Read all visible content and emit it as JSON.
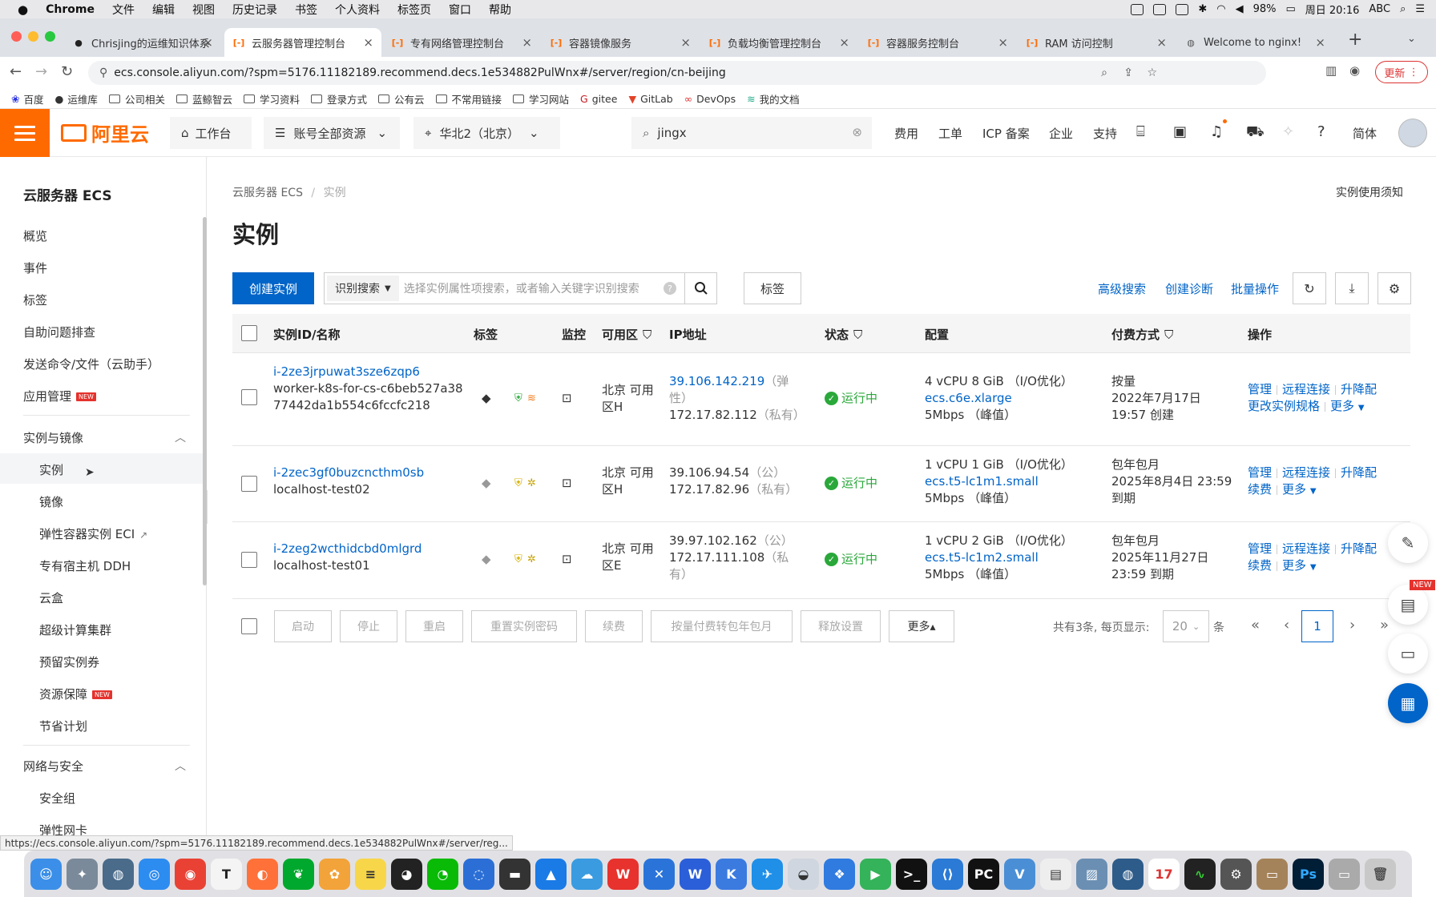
{
  "menubar": {
    "apple": "",
    "items": [
      "Chrome",
      "文件",
      "编辑",
      "视图",
      "历史记录",
      "书签",
      "个人资料",
      "标签页",
      "窗口",
      "帮助"
    ],
    "battery": "98%",
    "clock": "周日 20:16",
    "ime": "ABC"
  },
  "tabs": [
    {
      "title": "Chrisjing的运维知识体系",
      "icon": "github"
    },
    {
      "title": "云服务器管理控制台",
      "icon": "aliyun",
      "active": true
    },
    {
      "title": "专有网络管理控制台",
      "icon": "aliyun"
    },
    {
      "title": "容器镜像服务",
      "icon": "aliyun"
    },
    {
      "title": "负载均衡管理控制台",
      "icon": "aliyun"
    },
    {
      "title": "容器服务控制台",
      "icon": "aliyun"
    },
    {
      "title": "RAM 访问控制",
      "icon": "aliyun"
    },
    {
      "title": "Welcome to nginx!",
      "icon": "globe"
    }
  ],
  "address": {
    "url": "ecs.console.aliyun.com/?spm=5176.11182189.recommend.decs.1e534882PulWnx#/server/region/cn-beijing",
    "update_label": "更新"
  },
  "bookmarks": [
    "百度",
    "运维库",
    "公司相关",
    "蓝鲸智云",
    "学习资料",
    "登录方式",
    "公有云",
    "不常用链接",
    "学习网站",
    "gitee",
    "GitLab",
    "DevOps",
    "我的文档"
  ],
  "topnav": {
    "logo": "阿里云",
    "workbench": "工作台",
    "resources": "账号全部资源",
    "region": "华北2（北京）",
    "search_value": "jingx",
    "links": [
      "费用",
      "工单",
      "ICP 备案",
      "企业",
      "支持"
    ],
    "lang": "简体"
  },
  "sidebar": {
    "title": "云服务器 ECS",
    "top_items": [
      "概览",
      "事件",
      "标签",
      "自助问题排查",
      "发送命令/文件（云助手）",
      "应用管理"
    ],
    "group1": "实例与镜像",
    "group1_items": [
      "实例",
      "镜像",
      "弹性容器实例 ECI",
      "专有宿主机 DDH",
      "云盒",
      "超级计算集群",
      "预留实例券",
      "资源保障",
      "节省计划"
    ],
    "group2": "网络与安全",
    "group2_items": [
      "安全组",
      "弹性网卡"
    ],
    "new_badge": "NEW"
  },
  "main": {
    "breadcrumb_root": "云服务器 ECS",
    "breadcrumb_sep": "/",
    "breadcrumb_current": "实例",
    "title": "实例",
    "notice": "实例使用须知",
    "create_label": "创建实例",
    "search_mode": "识别搜索",
    "search_placeholder": "选择实例属性项搜索，或者输入关键字识别搜索",
    "tag_btn": "标签",
    "links": [
      "高级搜索",
      "创建诊断",
      "批量操作"
    ]
  },
  "table": {
    "headers": [
      "实例ID/名称",
      "标签",
      "监控",
      "可用区",
      "IP地址",
      "状态",
      "配置",
      "付费方式",
      "操作"
    ],
    "rows": [
      {
        "id": "i-2ze3jrpuwat3sze6zqp6",
        "name": "worker-k8s-for-cs-c6beb527a3877442da1b554c6fccfc218",
        "zone": "北京 可用区H",
        "ip1": "39.106.142.219",
        "ip1_tag": "（弹性）",
        "ip2": "172.17.82.112",
        "ip2_tag": "（私有）",
        "status": "运行中",
        "spec": "4 vCPU 8 GiB （I/O优化）",
        "type": "ecs.c6e.xlarge",
        "bw": "5Mbps （峰值）",
        "pay1": "按量",
        "pay2": "2022年7月17日",
        "pay3": "19:57 创建",
        "ops1": [
          "管理",
          "远程连接",
          "升降配"
        ],
        "ops2": [
          "更改实例规格",
          "更多"
        ]
      },
      {
        "id": "i-2zec3gf0buzcncthm0sb",
        "name": "localhost-test02",
        "zone": "北京 可用区H",
        "ip1": "39.106.94.54",
        "ip1_tag": "（公）",
        "ip2": "172.17.82.96",
        "ip2_tag": "（私有）",
        "status": "运行中",
        "spec": "1 vCPU 1 GiB （I/O优化）",
        "type": "ecs.t5-lc1m1.small",
        "bw": "5Mbps （峰值）",
        "pay1": "包年包月",
        "pay2": "2025年8月4日 23:59",
        "pay3": "到期",
        "ops1": [
          "管理",
          "远程连接",
          "升降配"
        ],
        "ops2": [
          "续费",
          "更多"
        ]
      },
      {
        "id": "i-2zeg2wcthidcbd0mlgrd",
        "name": "localhost-test01",
        "zone": "北京 可用区E",
        "ip1": "39.97.102.162",
        "ip1_tag": "（公）",
        "ip2": "172.17.111.108",
        "ip2_tag": "（私有）",
        "status": "运行中",
        "spec": "1 vCPU 2 GiB （I/O优化）",
        "type": "ecs.t5-lc1m2.small",
        "bw": "5Mbps （峰值）",
        "pay1": "包年包月",
        "pay2": "2025年11月27日",
        "pay3": "23:59 到期",
        "ops1": [
          "管理",
          "远程连接",
          "升降配"
        ],
        "ops2": [
          "续费",
          "更多"
        ]
      }
    ]
  },
  "batch": [
    "启动",
    "停止",
    "重启",
    "重置实例密码",
    "续费",
    "按量付费转包年包月",
    "释放设置",
    "更多▴"
  ],
  "pagination": {
    "summary": "共有3条, 每页显示:",
    "page_size": "20",
    "unit": "条",
    "current": "1"
  },
  "float_new": "NEW",
  "statusbar_url": "https://ecs.console.aliyun.com/?spm=5176.11182189.recommend.decs.1e534882PulWnx#/server/reg..."
}
